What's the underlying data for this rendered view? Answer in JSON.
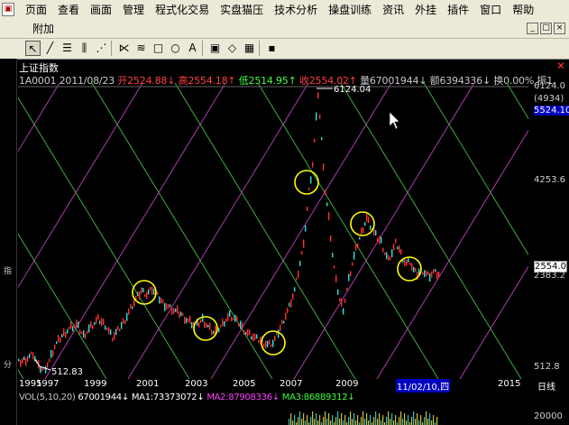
{
  "menubar": {
    "items": [
      "页面",
      "查看",
      "画面",
      "管理",
      "程式化交易",
      "实盘猫压",
      "技术分析",
      "操盘训练",
      "资讯",
      "外挂",
      "插件",
      "窗口",
      "帮助"
    ],
    "sub_item": "附加"
  },
  "window_controls": [
    "_",
    "□",
    "×"
  ],
  "toolbar": {
    "tools": [
      {
        "name": "pointer-tool",
        "glyph": "↖",
        "active": true
      },
      {
        "name": "line-tool",
        "glyph": "╱"
      },
      {
        "name": "fib-line-tool",
        "glyph": "☰"
      },
      {
        "name": "period-lines-tool",
        "glyph": "⫼"
      },
      {
        "name": "gann-fan-tool",
        "glyph": "⋰"
      },
      {
        "name": "ray-fan-tool",
        "glyph": "⋉"
      },
      {
        "name": "parallel-tool",
        "glyph": "≋"
      },
      {
        "name": "rectangle-tool",
        "glyph": "□"
      },
      {
        "name": "ellipse-tool",
        "glyph": "○"
      },
      {
        "name": "text-tool",
        "glyph": "A"
      },
      {
        "name": "image-tool",
        "glyph": "▣"
      },
      {
        "name": "eraser-tool",
        "glyph": "◇"
      },
      {
        "name": "color-tool",
        "glyph": "▦"
      },
      {
        "name": "save-tool",
        "glyph": "▪"
      }
    ]
  },
  "chart": {
    "title": "上证指数",
    "code_date": "1A0001 2011/08/23",
    "open": "开2524.88↓",
    "high": "高2554.18↑",
    "low": "低2514.95↑",
    "close": "收2554.02↑",
    "volume": "量67001944↓",
    "amount": "额6394336↓",
    "turnover": "换0.00%",
    "amplitude": "振1.",
    "peak_label": "6124.04",
    "low_label": "512.83",
    "price_axis": {
      "p6124": "6124.0",
      "p4934": "(4934)",
      "p5524": "5524.10",
      "p4253": "4253.6",
      "p2554": "2554.0",
      "p2383": "2383.2",
      "p512": "512.8"
    },
    "x_labels": [
      "1995",
      "1997",
      "1999",
      "2001",
      "2003",
      "2005",
      "2007",
      "2009",
      "13",
      "2015",
      "日线"
    ],
    "cursor_date": "11/02/10,四"
  },
  "volume_panel": {
    "label": "VOL(5,10,20)",
    "vol": "67001944↓",
    "ma1": "MA1:73373072↓",
    "ma2": "MA2:87908336↓",
    "ma3": "MA3:86889312↓",
    "axis": "20000"
  },
  "side_tabs": [
    "指",
    "分"
  ],
  "colors": {
    "green_lines": "#40c040",
    "magenta_lines": "#c040c0",
    "circles": "#ffff00",
    "up_candle": "#ff3030",
    "down_candle": "#30e0e0"
  }
}
